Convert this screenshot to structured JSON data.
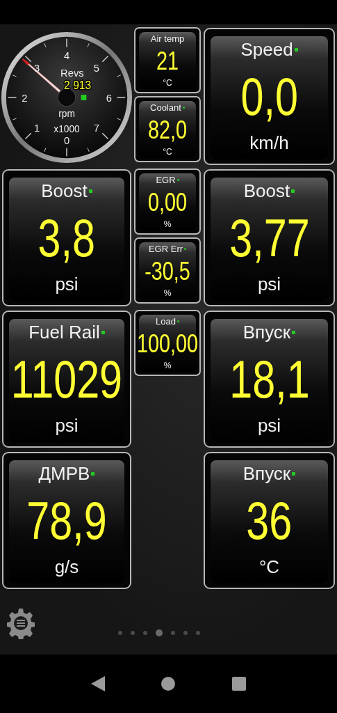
{
  "dial": {
    "label": "Revs",
    "value": "2 913",
    "unit": "rpm",
    "scale": "x1000",
    "ticks": [
      "0",
      "1",
      "2",
      "3",
      "4",
      "5",
      "6",
      "7"
    ],
    "indicator": true
  },
  "rows": [
    {
      "left": null,
      "middle": [
        {
          "label": "Air temp",
          "value": "21",
          "unit": "°C",
          "indicator": false
        },
        {
          "label": "Coolant",
          "value": "82,0",
          "unit": "°C",
          "indicator": true
        }
      ],
      "right": {
        "label": "Speed",
        "value": "0,0",
        "unit": "km/h",
        "indicator": true
      }
    },
    {
      "left": {
        "label": "Boost",
        "value": "3,8",
        "unit": "psi",
        "indicator": true
      },
      "middle": [
        {
          "label": "EGR",
          "value": "0,00",
          "unit": "%",
          "indicator": true
        },
        {
          "label": "EGR Err",
          "value": "-30,5",
          "unit": "%",
          "indicator": true
        }
      ],
      "right": {
        "label": "Boost",
        "value": "3,77",
        "unit": "psi",
        "indicator": true
      }
    },
    {
      "left": {
        "label": "Fuel Rail",
        "value": "11029",
        "unit": "psi",
        "indicator": true
      },
      "middle": [
        {
          "label": "Load",
          "value": "100,00",
          "unit": "%",
          "indicator": true
        }
      ],
      "right": {
        "label": "Впуск",
        "value": "18,1",
        "unit": "psi",
        "indicator": true
      }
    },
    {
      "left": {
        "label": "ДМРВ",
        "value": "78,9",
        "unit": "g/s",
        "indicator": true
      },
      "right": {
        "label": "Впуск",
        "value": "36",
        "unit": "°C",
        "indicator": true
      }
    }
  ],
  "pages": [
    {
      "selected": false
    },
    {
      "selected": false
    },
    {
      "selected": false
    },
    {
      "selected": true
    },
    {
      "selected": false
    },
    {
      "selected": false
    },
    {
      "selected": false
    }
  ]
}
